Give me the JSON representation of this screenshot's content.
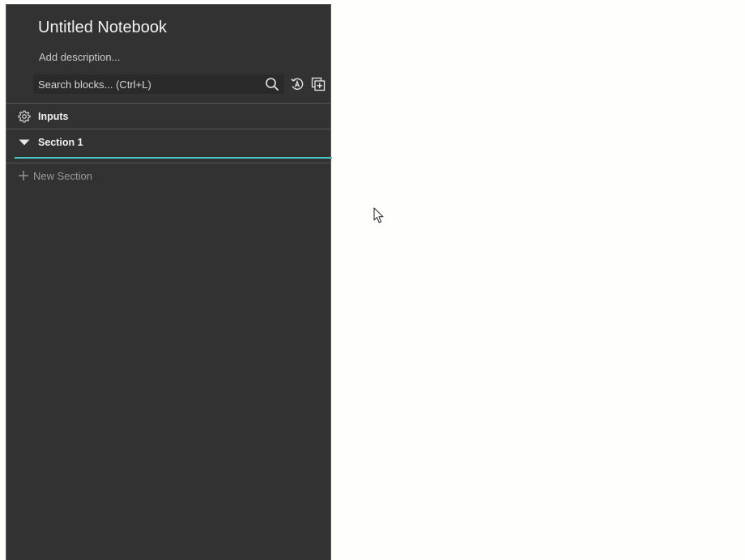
{
  "notebook": {
    "title": "Untitled Notebook",
    "description_placeholder": "Add description..."
  },
  "search": {
    "placeholder": "Search blocks... (Ctrl+L)",
    "value": ""
  },
  "toolbar": {
    "icons": [
      "search-icon",
      "auto-run-icon",
      "add-block-icon"
    ]
  },
  "sections": [
    {
      "label": "Inputs",
      "icon": "gear-icon"
    },
    {
      "label": "Section 1",
      "icon": "caret-down-icon",
      "expanded": true
    }
  ],
  "new_section": {
    "label": "New Section",
    "icon": "plus-icon"
  },
  "colors": {
    "panel_bg": "#323232",
    "accent": "#4cc2c4",
    "page_bg": "#fefefc"
  }
}
